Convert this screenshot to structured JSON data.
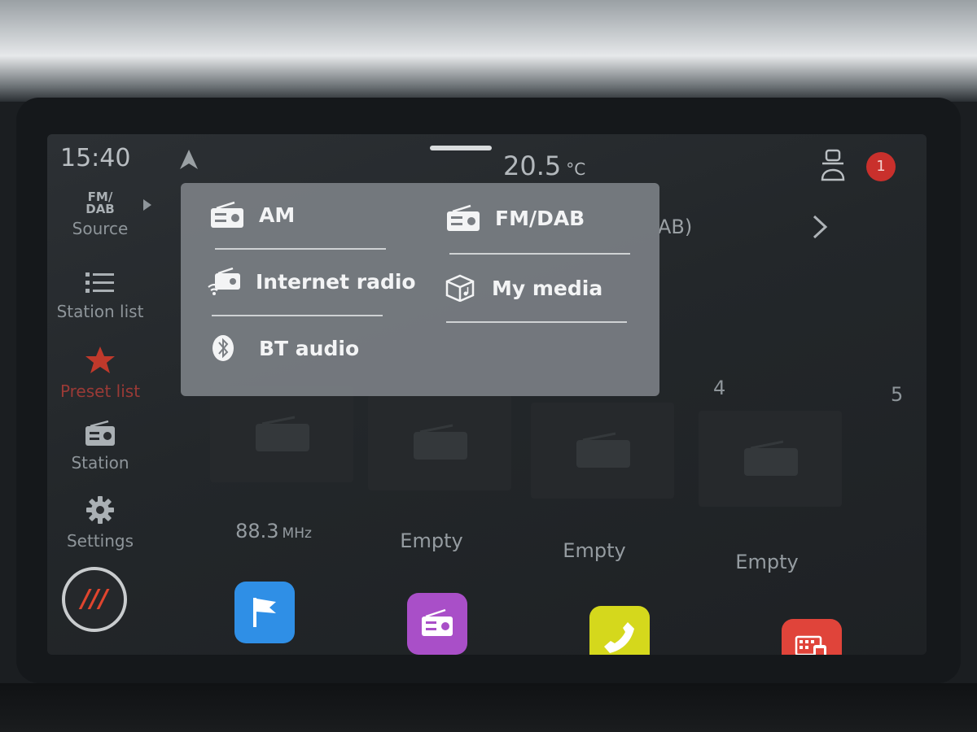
{
  "status_bar": {
    "time": "15:40",
    "temperature": "20.5",
    "temperature_unit": "°C",
    "notification_count": "1"
  },
  "background": {
    "band_suffix": "AB)"
  },
  "sidebar": {
    "source_current": "FM/\nDAB",
    "source_label": "Source",
    "station_list_label": "Station list",
    "preset_list_label": "Preset list",
    "station_label": "Station",
    "settings_label": "Settings",
    "menu_glyph": "///"
  },
  "presets": {
    "numbers": [
      "4",
      "5"
    ],
    "items": [
      {
        "label": "88.3",
        "unit": "MHz"
      },
      {
        "label": "Empty",
        "unit": ""
      },
      {
        "label": "Empty",
        "unit": ""
      },
      {
        "label": "Empty",
        "unit": ""
      }
    ]
  },
  "source_popup": {
    "items": [
      {
        "label": "AM",
        "icon": "radio-icon"
      },
      {
        "label": "FM/DAB",
        "icon": "radio-icon"
      },
      {
        "label": "Internet radio",
        "icon": "internet-radio-icon"
      },
      {
        "label": "My media",
        "icon": "media-box-icon"
      },
      {
        "label": "BT audio",
        "icon": "bluetooth-icon"
      }
    ]
  },
  "dock": {
    "apps": [
      {
        "name": "navigation",
        "icon": "flag-icon",
        "color": "#2f8fe6"
      },
      {
        "name": "radio",
        "icon": "radio-icon",
        "color": "#a94fc8"
      },
      {
        "name": "phone",
        "icon": "phone-icon",
        "color": "#d5d81c"
      },
      {
        "name": "apps",
        "icon": "smartphone-icon",
        "color": "#e0443a"
      }
    ],
    "pages": 2,
    "active_page": 1
  },
  "colors": {
    "accent_red": "#e0452e",
    "favorite_red": "#c0392b",
    "popup_bg": "#7a7e83"
  }
}
